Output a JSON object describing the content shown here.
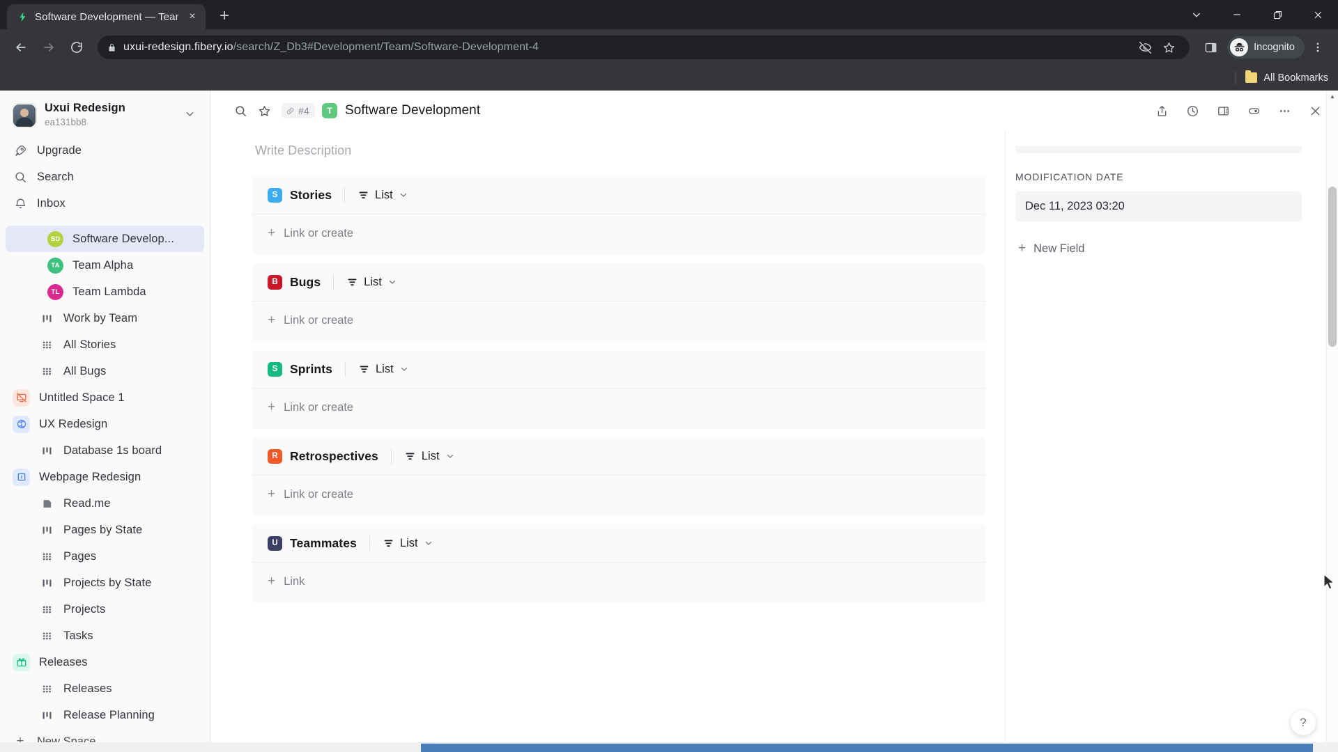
{
  "browser": {
    "tab": {
      "title": "Software Development — Team",
      "favicon": "fibery-logo-icon",
      "close": "×"
    },
    "new_tab": "+",
    "window_controls": {
      "tab_search": "tab-search-chevron",
      "minimize": "—",
      "restore": "restore",
      "close": "×"
    },
    "nav": {
      "back": "←",
      "forward": "→",
      "reload": "⟳"
    },
    "omnibox": {
      "lock": "lock-icon",
      "url_domain": "uxui-redesign.fibery.io",
      "url_path": "/search/Z_Db3#Development/Team/Software-Development-4",
      "url_full": "uxui-redesign.fibery.io/search/Z_Db3#Development/Team/Software-Development-4",
      "tracking_icon": "eye-off-icon",
      "bookmark_icon": "star-icon"
    },
    "side_panel_icon": "side-panel-icon",
    "profile": {
      "label": "Incognito",
      "icon": "incognito-hat-icon"
    },
    "menu_icon": "kebab-menu-icon",
    "bookmarks": {
      "folder_icon": "folder-icon",
      "label": "All Bookmarks"
    }
  },
  "sidebar": {
    "workspace": {
      "name": "Uxui Redesign",
      "id": "ea131bb8",
      "chevron": "chevron-down-icon",
      "avatar": "user-avatar"
    },
    "top_items": [
      {
        "label": "Upgrade",
        "icon": "rocket-icon"
      },
      {
        "label": "Search",
        "icon": "search-icon"
      },
      {
        "label": "Inbox",
        "icon": "bell-icon"
      }
    ],
    "entries": [
      {
        "label": "Software Develop...",
        "kind": "circle",
        "initials": "SD",
        "color": "#b5d13f",
        "indent": 2,
        "active": true
      },
      {
        "label": "Team Alpha",
        "kind": "circle",
        "initials": "TA",
        "color": "#3ec17d",
        "indent": 2,
        "active": false
      },
      {
        "label": "Team Lambda",
        "kind": "circle",
        "initials": "TL",
        "color": "#d92a90",
        "indent": 2,
        "active": false
      },
      {
        "label": "Work by Team",
        "kind": "board",
        "indent": 1,
        "active": false
      },
      {
        "label": "All Stories",
        "kind": "grid",
        "indent": 1,
        "active": false
      },
      {
        "label": "All Bugs",
        "kind": "grid",
        "indent": 1,
        "active": false
      },
      {
        "label": "Untitled Space 1",
        "kind": "space",
        "icon": "no-screen-icon",
        "bg": "#ffe6de",
        "fg": "#f4663c",
        "indent": 0,
        "active": false
      },
      {
        "label": "UX Redesign",
        "kind": "space",
        "icon": "brain-icon",
        "bg": "#dfe9ff",
        "fg": "#4a7df0",
        "indent": 0,
        "active": false
      },
      {
        "label": "Database 1s board",
        "kind": "board",
        "indent": 1,
        "active": false
      },
      {
        "label": "Webpage Redesign",
        "kind": "space",
        "icon": "square-dot-icon",
        "bg": "#dfe9ff",
        "fg": "#3d7ae8",
        "indent": 0,
        "active": false
      },
      {
        "label": "Read.me",
        "kind": "doc",
        "indent": 1,
        "active": false
      },
      {
        "label": "Pages by State",
        "kind": "board",
        "indent": 1,
        "active": false
      },
      {
        "label": "Pages",
        "kind": "grid",
        "indent": 1,
        "active": false
      },
      {
        "label": "Projects by State",
        "kind": "board",
        "indent": 1,
        "active": false
      },
      {
        "label": "Projects",
        "kind": "grid",
        "indent": 1,
        "active": false
      },
      {
        "label": "Tasks",
        "kind": "grid",
        "indent": 1,
        "active": false
      },
      {
        "label": "Releases",
        "kind": "space",
        "icon": "gift-icon",
        "bg": "#d9f7ea",
        "fg": "#16b981",
        "indent": 0,
        "active": false
      },
      {
        "label": "Releases",
        "kind": "grid",
        "indent": 1,
        "active": false
      },
      {
        "label": "Release Planning",
        "kind": "board",
        "indent": 1,
        "active": false
      }
    ],
    "new_space": {
      "label": "New Space",
      "plus": "+"
    }
  },
  "entity": {
    "header": {
      "search_icon": "search-icon",
      "star_icon": "star-icon",
      "link_icon": "link-icon",
      "id": "#4",
      "type_badge": "T",
      "type_badge_color": "#5fc97f",
      "title": "Software Development",
      "actions": [
        {
          "name": "share-icon",
          "glyph": "share"
        },
        {
          "name": "history-icon",
          "glyph": "clock"
        },
        {
          "name": "layout-panel-icon",
          "glyph": "panel"
        },
        {
          "name": "visibility-toggle-icon",
          "glyph": "toggle"
        },
        {
          "name": "more-options-icon",
          "glyph": "dots"
        },
        {
          "name": "close-icon",
          "glyph": "close"
        }
      ]
    },
    "description_placeholder": "Write Description",
    "relations": [
      {
        "name": "Stories",
        "badge": "S",
        "color": "#3dabf0",
        "view": "List",
        "action": "Link or create"
      },
      {
        "name": "Bugs",
        "badge": "B",
        "color": "#c9182b",
        "view": "List",
        "action": "Link or create"
      },
      {
        "name": "Sprints",
        "badge": "S",
        "color": "#16b981",
        "view": "List",
        "action": "Link or create"
      },
      {
        "name": "Retrospectives",
        "badge": "R",
        "color": "#f05a28",
        "view": "List",
        "action": "Link or create"
      },
      {
        "name": "Teammates",
        "badge": "U",
        "color": "#3b3f63",
        "view": "List",
        "action": "Link"
      }
    ]
  },
  "right_panel": {
    "fields": [
      {
        "label": "MODIFICATION DATE",
        "value": "Dec 11, 2023 03:20"
      }
    ],
    "new_field": {
      "label": "New Field",
      "plus": "+"
    }
  },
  "help": {
    "glyph": "?"
  }
}
